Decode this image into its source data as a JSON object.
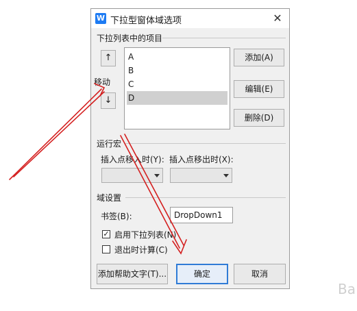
{
  "window": {
    "icon_letter": "W",
    "title": "下拉型窗体域选项",
    "close_glyph": "✕"
  },
  "items_section": {
    "label": "下拉列表中的项目",
    "up_glyph": "↑",
    "down_glyph": "↓",
    "move_label": "移动",
    "items": [
      {
        "label": "A",
        "selected": false
      },
      {
        "label": "B",
        "selected": false
      },
      {
        "label": "C",
        "selected": false
      },
      {
        "label": "D",
        "selected": true
      }
    ],
    "add_label": "添加(A)",
    "edit_label": "编辑(E)",
    "delete_label": "删除(D)"
  },
  "macro_section": {
    "label": "运行宏",
    "entry_label": "插入点移入时(Y):",
    "exit_label": "插入点移出时(X):",
    "entry_value": "",
    "exit_value": ""
  },
  "field_section": {
    "label": "域设置",
    "bookmark_label": "书签(B):",
    "bookmark_value": "DropDown1",
    "enable_dropdown_label": "启用下拉列表(N)",
    "enable_dropdown_checked": true,
    "calc_on_exit_label": "退出时计算(C)",
    "calc_on_exit_checked": false
  },
  "footer": {
    "help_text_label": "添加帮助文字(T)...",
    "ok_label": "确定",
    "cancel_label": "取消"
  },
  "watermark_text": "Ba",
  "colors": {
    "annotation_arrow": "#d42020",
    "primary_border": "#2f7bd6",
    "app_icon": "#1d7bf3"
  }
}
